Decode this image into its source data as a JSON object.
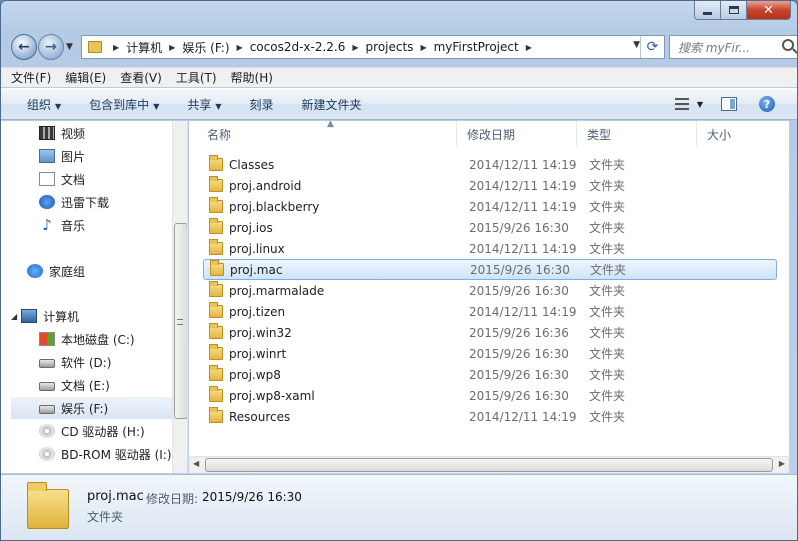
{
  "window": {
    "close_glyph": "✕"
  },
  "address": {
    "crumbs": [
      "计算机",
      "娱乐 (F:)",
      "cocos2d-x-2.2.6",
      "projects",
      "myFirstProject"
    ],
    "search_placeholder": "搜索 myFir..."
  },
  "menubar": {
    "items": [
      "文件(F)",
      "编辑(E)",
      "查看(V)",
      "工具(T)",
      "帮助(H)"
    ]
  },
  "toolbar": {
    "organize": "组织",
    "include_in_library": "包含到库中",
    "share": "共享",
    "burn": "刻录",
    "new_folder": "新建文件夹"
  },
  "navpane": {
    "items": [
      {
        "label": "视频",
        "icon": "video-icon"
      },
      {
        "label": "图片",
        "icon": "pictures-icon"
      },
      {
        "label": "文档",
        "icon": "documents-icon"
      },
      {
        "label": "迅雷下载",
        "icon": "xunlei-icon"
      },
      {
        "label": "音乐",
        "icon": "music-icon"
      },
      {
        "label": "家庭组",
        "icon": "homegroup-icon"
      },
      {
        "label": "计算机",
        "icon": "computer-icon"
      },
      {
        "label": "本地磁盘 (C:)",
        "icon": "windows-drive-icon"
      },
      {
        "label": "软件 (D:)",
        "icon": "drive-icon"
      },
      {
        "label": "文档 (E:)",
        "icon": "drive-icon"
      },
      {
        "label": "娱乐 (F:)",
        "icon": "drive-icon",
        "selected": true
      },
      {
        "label": "CD 驱动器 (H:)",
        "icon": "cd-drive-icon"
      },
      {
        "label": "BD-ROM 驱动器 (I:)",
        "icon": "bd-drive-icon"
      }
    ]
  },
  "columns": {
    "name": "名称",
    "date": "修改日期",
    "type": "类型",
    "size": "大小"
  },
  "files": [
    {
      "name": "Classes",
      "date": "2014/12/11 14:19",
      "type": "文件夹"
    },
    {
      "name": "proj.android",
      "date": "2014/12/11 14:19",
      "type": "文件夹"
    },
    {
      "name": "proj.blackberry",
      "date": "2014/12/11 14:19",
      "type": "文件夹"
    },
    {
      "name": "proj.ios",
      "date": "2015/9/26 16:30",
      "type": "文件夹"
    },
    {
      "name": "proj.linux",
      "date": "2014/12/11 14:19",
      "type": "文件夹"
    },
    {
      "name": "proj.mac",
      "date": "2015/9/26 16:30",
      "type": "文件夹",
      "selected": true
    },
    {
      "name": "proj.marmalade",
      "date": "2015/9/26 16:30",
      "type": "文件夹"
    },
    {
      "name": "proj.tizen",
      "date": "2014/12/11 14:19",
      "type": "文件夹"
    },
    {
      "name": "proj.win32",
      "date": "2015/9/26 16:36",
      "type": "文件夹"
    },
    {
      "name": "proj.winrt",
      "date": "2015/9/26 16:30",
      "type": "文件夹"
    },
    {
      "name": "proj.wp8",
      "date": "2015/9/26 16:30",
      "type": "文件夹"
    },
    {
      "name": "proj.wp8-xaml",
      "date": "2015/9/26 16:30",
      "type": "文件夹"
    },
    {
      "name": "Resources",
      "date": "2014/12/11 14:19",
      "type": "文件夹"
    }
  ],
  "details": {
    "name": "proj.mac",
    "date_label": "修改日期:",
    "date_value": "2015/9/26 16:30",
    "type": "文件夹"
  }
}
